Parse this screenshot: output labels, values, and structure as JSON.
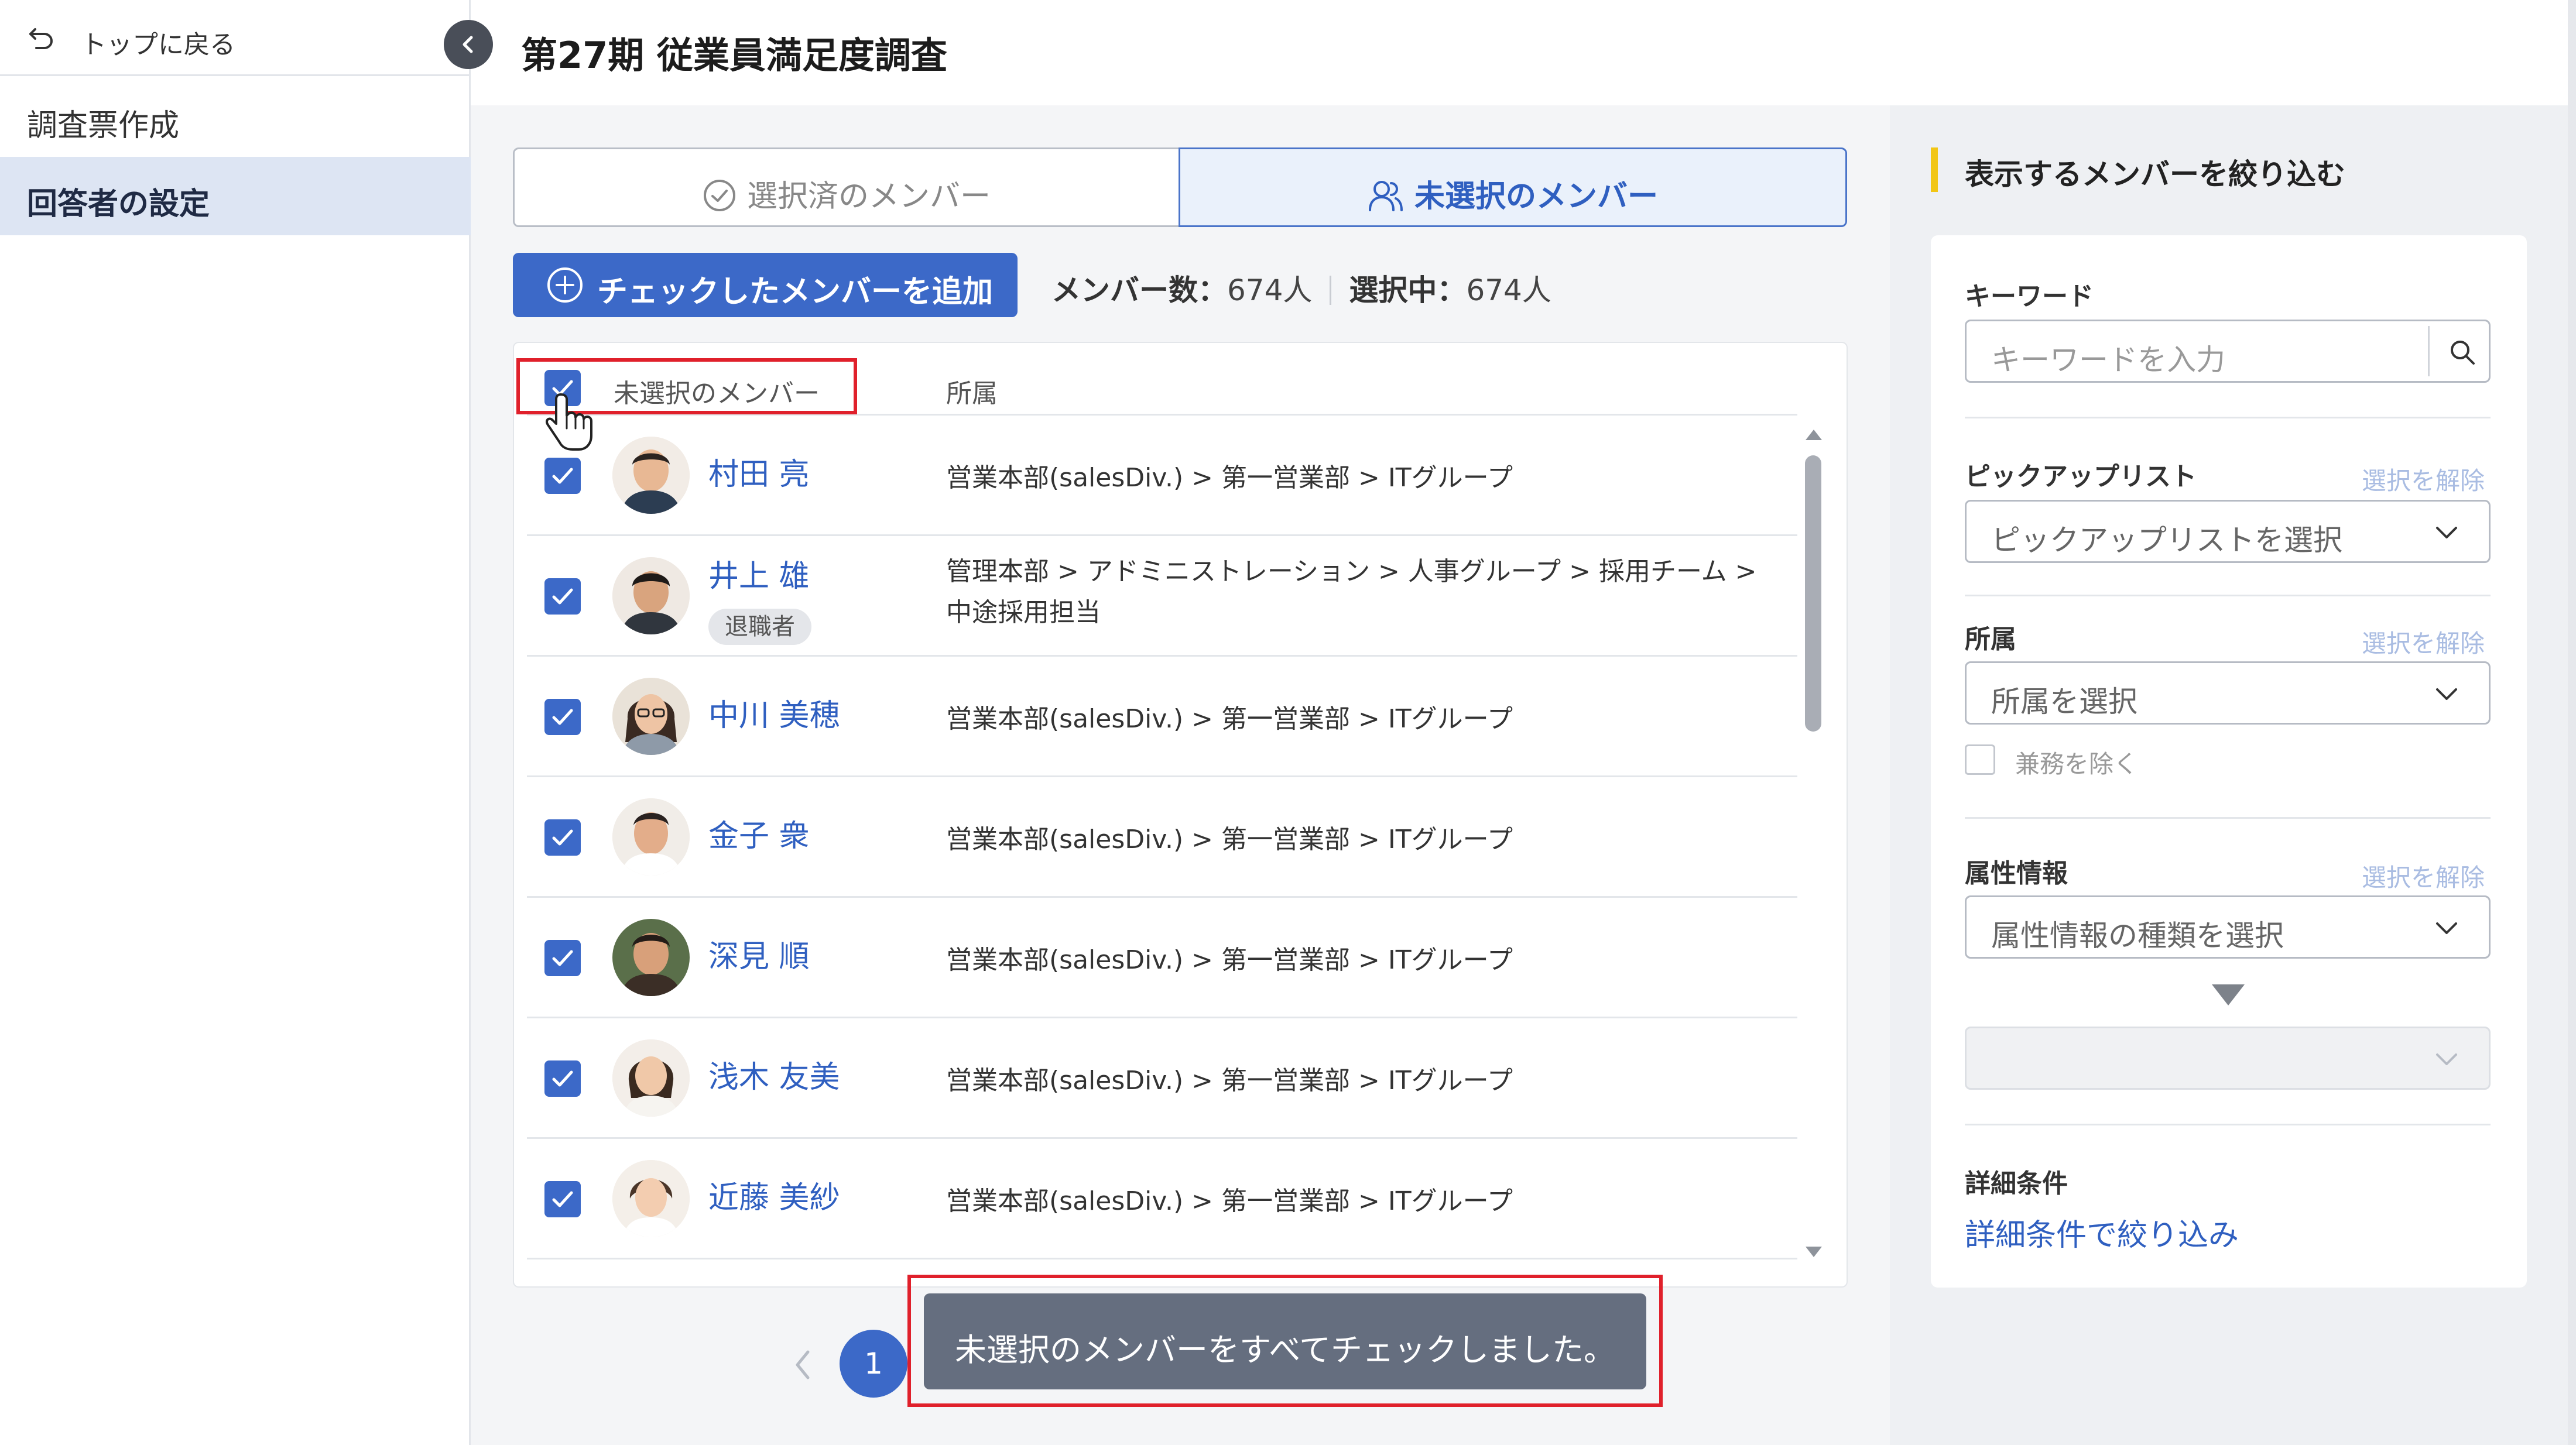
{
  "sidebar": {
    "back_label": "トップに戻る",
    "items": [
      {
        "label": "調査票作成"
      },
      {
        "label": "回答者の設定"
      }
    ]
  },
  "header": {
    "title": "第27期 従業員満足度調査"
  },
  "tabs": [
    {
      "label": "選択済のメンバー"
    },
    {
      "label": "未選択のメンバー"
    }
  ],
  "toolbar": {
    "add_label": "チェックしたメンバーを追加",
    "member_count_label": "メンバー数：",
    "member_count": "674人",
    "selected_label": "選択中：",
    "selected_count": "674人"
  },
  "table": {
    "header_label": "未選択のメンバー",
    "header_affiliation": "所属",
    "rows": [
      {
        "name": "村田 亮",
        "affiliation": "営業本部(salesDiv.) > 第一営業部 > ITグループ",
        "badge": ""
      },
      {
        "name": "井上 雄",
        "affiliation": "管理本部 > アドミニストレーション > 人事グループ > 採用チーム > 中途採用担当",
        "badge": "退職者"
      },
      {
        "name": "中川 美穂",
        "affiliation": "営業本部(salesDiv.) > 第一営業部 > ITグループ",
        "badge": ""
      },
      {
        "name": "金子 衆",
        "affiliation": "営業本部(salesDiv.) > 第一営業部 > ITグループ",
        "badge": ""
      },
      {
        "name": "深見 順",
        "affiliation": "営業本部(salesDiv.) > 第一営業部 > ITグループ",
        "badge": ""
      },
      {
        "name": "浅木 友美",
        "affiliation": "営業本部(salesDiv.) > 第一営業部 > ITグループ",
        "badge": ""
      },
      {
        "name": "近藤 美紗",
        "affiliation": "営業本部(salesDiv.) > 第一営業部 > ITグループ",
        "badge": ""
      }
    ]
  },
  "pagination": {
    "current": "1"
  },
  "toast": {
    "message": "未選択のメンバーをすべてチェックしました。"
  },
  "filter": {
    "title": "表示するメンバーを絞り込む",
    "keyword": {
      "label": "キーワード",
      "placeholder": "キーワードを入力"
    },
    "pickup": {
      "label": "ピックアップリスト",
      "clear": "選択を解除",
      "value": "ピックアップリストを選択"
    },
    "affiliation": {
      "label": "所属",
      "clear": "選択を解除",
      "value": "所属を選択",
      "exclude_label": "兼務を除く"
    },
    "attribute": {
      "label": "属性情報",
      "clear": "選択を解除",
      "value": "属性情報の種類を選択"
    },
    "detail": {
      "label": "詳細条件",
      "link": "詳細条件で絞り込み"
    }
  },
  "colors": {
    "accent": "#3c69c8",
    "highlight": "#e0202b",
    "toast_bg": "#656e7f",
    "filter_title_bar": "#f2c615"
  }
}
